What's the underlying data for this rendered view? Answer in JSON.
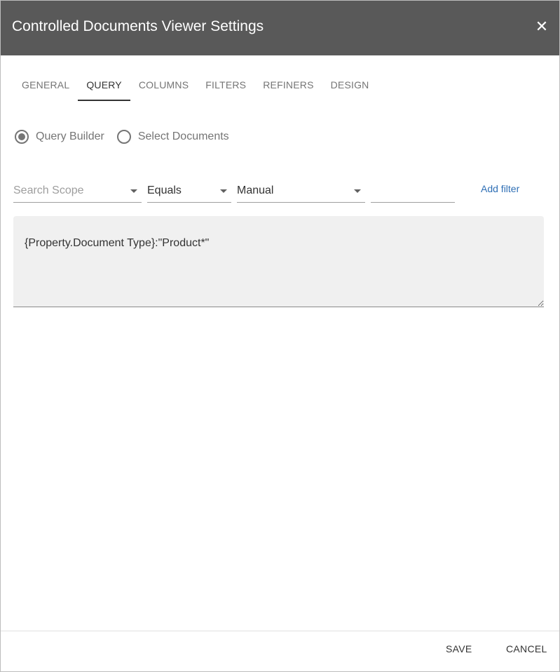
{
  "dialog": {
    "title": "Controlled Documents Viewer Settings",
    "close_glyph": "✕"
  },
  "tabs": [
    {
      "label": "GENERAL",
      "active": false
    },
    {
      "label": "QUERY",
      "active": true
    },
    {
      "label": "COLUMNS",
      "active": false
    },
    {
      "label": "FILTERS",
      "active": false
    },
    {
      "label": "REFINERS",
      "active": false
    },
    {
      "label": "DESIGN",
      "active": false
    }
  ],
  "query_mode": {
    "options": [
      {
        "label": "Query Builder",
        "selected": true
      },
      {
        "label": "Select Documents",
        "selected": false
      }
    ]
  },
  "filter_row": {
    "scope_placeholder": "Search Scope",
    "operator_value": "Equals",
    "value_type": "Manual",
    "value_input": "",
    "add_filter_label": "Add filter"
  },
  "query_text": "{Property.Document Type}:\"Product*\"",
  "footer": {
    "save_label": "SAVE",
    "cancel_label": "CANCEL"
  },
  "colors": {
    "header_bg": "#595959",
    "link": "#2f6fb5",
    "query_bg": "#f0f0f0"
  }
}
